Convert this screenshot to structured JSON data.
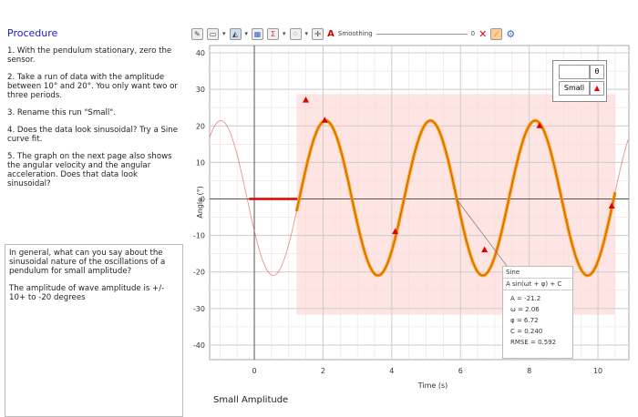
{
  "procedure": {
    "title": "Procedure",
    "steps": [
      "1.  With the pendulum stationary, zero the sensor.",
      "2.  Take a run of data with the amplitude between 10° and 20°.  You only want two or three periods.",
      "3.  Rename this run \"Small\".",
      "4.  Does the data look sinusoidal?  Try a Sine curve fit.",
      "5.  The graph on the next page also shows the angular velocity  and the angular acceleration.  Does that data look sinusoidal?"
    ]
  },
  "question": {
    "prompt": "In general, what can you say about the sinusoidal nature of the oscillations of a pendulum for small amplitude?",
    "answer": "The amplitude of wave amplitude is +/- 10+ to -20 degrees"
  },
  "toolbar": {
    "smoothing_label": "Smoothing",
    "smoothing_value": "0",
    "text_icon": "A"
  },
  "legend": {
    "header_symbol": "θ",
    "run_name": "Small"
  },
  "fit": {
    "name": "Sine",
    "equation": "A sin(ωt + φ) + C",
    "params": [
      "A = -21.2",
      "ω = 2.06",
      "φ = 6.72",
      "C = 0.240",
      "RMSE = 0.592"
    ]
  },
  "caption": "Small Amplitude",
  "colors": {
    "data": "#ff9900",
    "fit": "#e05050",
    "marker": "#e00000",
    "shade": "#ffe4e4",
    "accent": "#1a1ad0"
  },
  "chart_data": {
    "type": "line",
    "xlabel": "Time (s)",
    "ylabel": "Angle (°)",
    "xlim": [
      -1.3,
      10.9
    ],
    "ylim": [
      -44,
      42
    ],
    "xticks": [
      0,
      2,
      4,
      6,
      8,
      10
    ],
    "yticks": [
      -40,
      -30,
      -20,
      -10,
      0,
      10,
      20,
      30,
      40
    ],
    "fit_params": {
      "A": -21.2,
      "w": 2.06,
      "phi": 6.72,
      "C": 0.24
    },
    "fit_range": [
      1.23,
      10.5
    ],
    "flat_segment": [
      -0.15,
      1.25
    ],
    "markers": [
      [
        1.5,
        27
      ],
      [
        2.05,
        21.5
      ],
      [
        4.1,
        -9
      ],
      [
        6.7,
        -14
      ],
      [
        8.3,
        20
      ],
      [
        10.4,
        -2
      ]
    ]
  }
}
